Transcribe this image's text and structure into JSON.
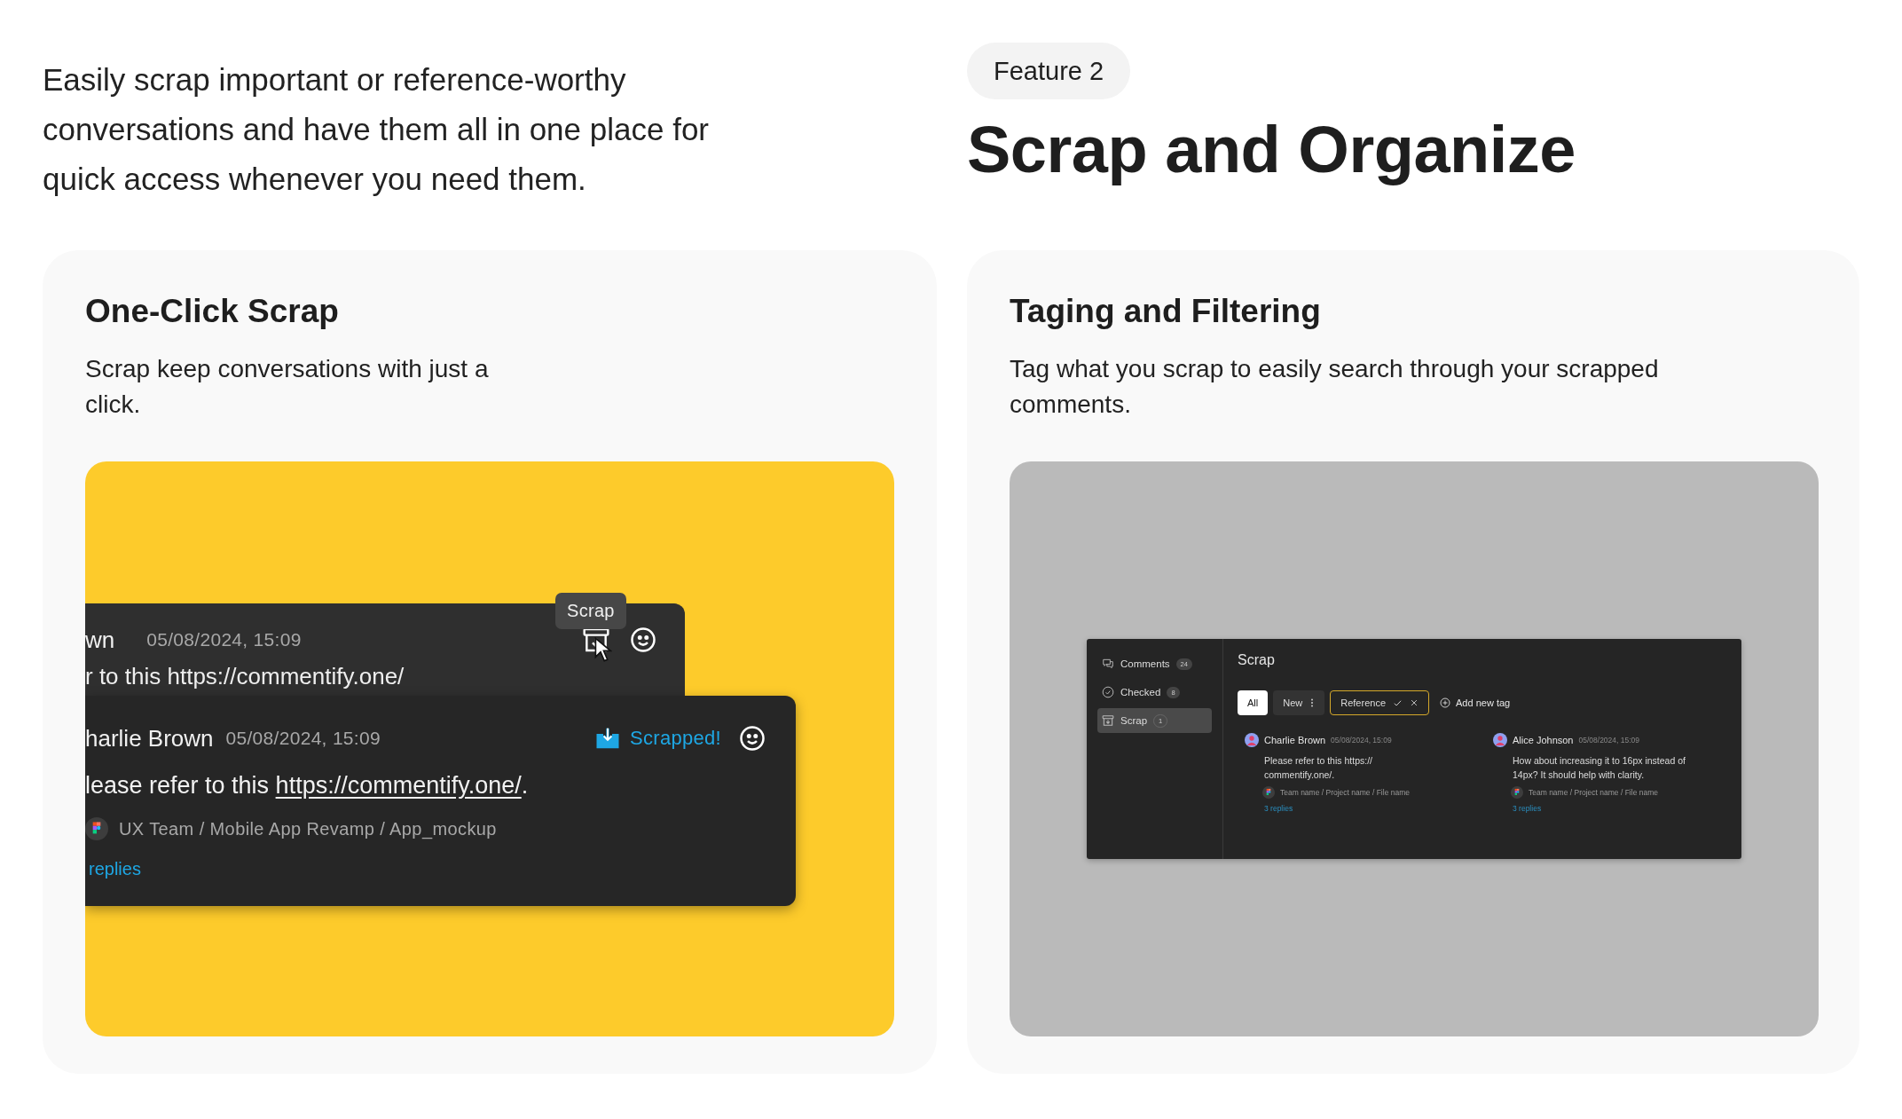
{
  "intro": {
    "text": "Easily scrap important or reference-worthy conversations and have them all in one place for quick access whenever you need them."
  },
  "feature": {
    "badge": "Feature 2",
    "title": "Scrap and Organize"
  },
  "cards": [
    {
      "kind": "scrap",
      "title": "One-Click Scrap",
      "description": "Scrap keep conversations with just a click.",
      "demo": {
        "back_comment": {
          "author": "wn",
          "date": "05/08/2024, 15:09",
          "text": "r to this https://commentify.one/",
          "tooltip": "Scrap"
        },
        "front_comment": {
          "author": "harlie Brown",
          "date": "05/08/2024, 15:09",
          "status": "Scrapped!",
          "text_before": "lease refer to this ",
          "link": "https://commentify.one/",
          "text_after": ".",
          "path": "UX Team / Mobile App Revamp / App_mockup",
          "replies": "replies"
        }
      }
    },
    {
      "kind": "tagging",
      "title": "Taging and Filtering",
      "description": "Tag what you scrap to easily search through your scrapped comments.",
      "demo": {
        "sidebar": [
          {
            "kind": "comments",
            "label": "Comments",
            "count": "24",
            "selected": false
          },
          {
            "kind": "checked",
            "label": "Checked",
            "count": "8",
            "selected": false
          },
          {
            "kind": "scrap",
            "label": "Scrap",
            "count": "1",
            "selected": true
          }
        ],
        "title": "Scrap",
        "tags": [
          {
            "kind": "plain",
            "label": "All",
            "selected": true
          },
          {
            "kind": "menu",
            "label": "New",
            "selected": false
          },
          {
            "kind": "editing",
            "label": "Reference",
            "selected": false
          }
        ],
        "add_tag": "Add new tag",
        "comments": [
          {
            "author": "Charlie Brown",
            "date": "05/08/2024, 15:09",
            "text": "Please refer to this https:// commentify.one/.",
            "path": "Team name / Project name / File name",
            "replies": "3 replies"
          },
          {
            "author": "Alice Johnson",
            "date": "05/08/2024, 15:09",
            "text": "How about increasing it to 16px instead of 14px? It should help with clarity.",
            "path": "Team name / Project name / File name",
            "replies": "3 replies"
          }
        ]
      }
    }
  ]
}
